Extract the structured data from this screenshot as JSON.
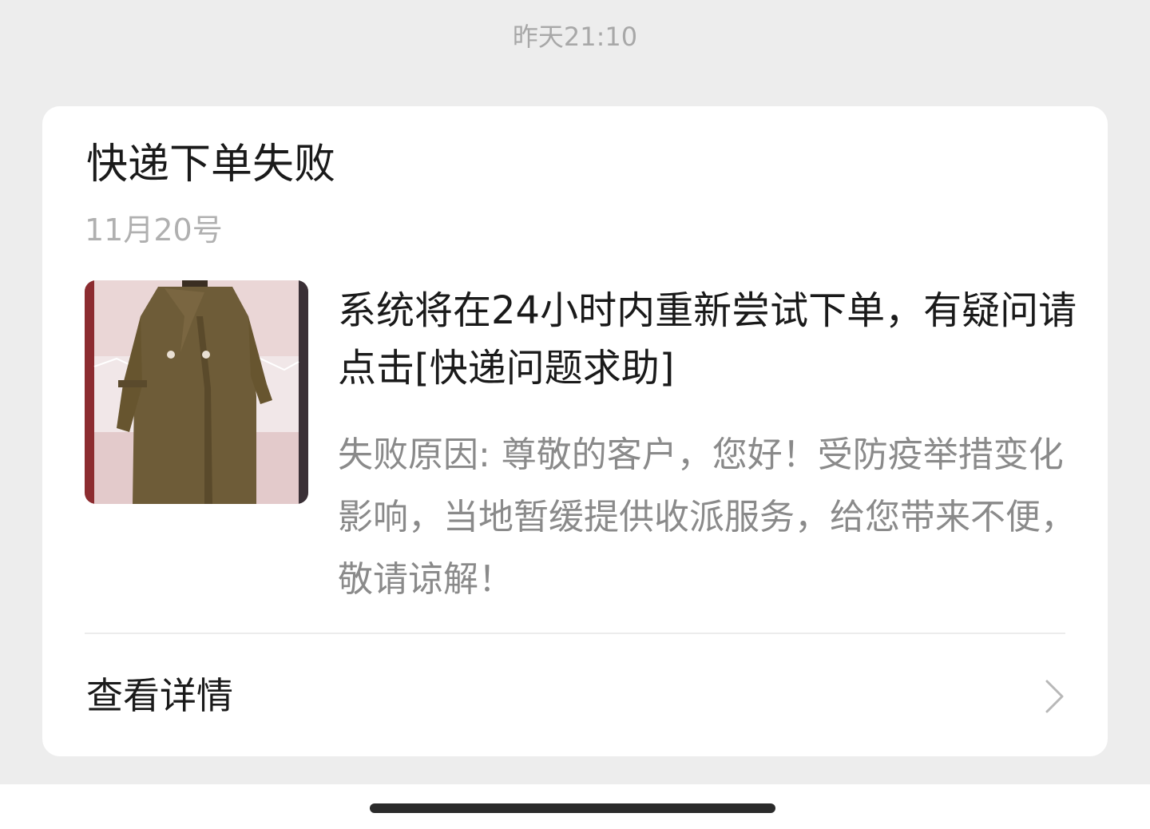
{
  "message": {
    "timestamp": "昨天21:10"
  },
  "card": {
    "title": "快递下单失败",
    "date": "11月20号",
    "thumbnail_icon": "coat-product-image",
    "headline": "系统将在24小时内重新尝试下单，有疑问请点击[快递问题求助]",
    "reason": "失败原因: 尊敬的客户，您好！受防疫举措变化影响，当地暂缓提供收派服务，给您带来不便，敬请谅解！",
    "details_label": "查看详情",
    "details_icon": "chevron-right-icon"
  },
  "colors": {
    "background": "#ededed",
    "card": "#ffffff",
    "title_text": "#1a1a1a",
    "secondary_text": "#8a8a8a",
    "timestamp_text": "#a8a8a8",
    "coat": "#6e5c38"
  }
}
